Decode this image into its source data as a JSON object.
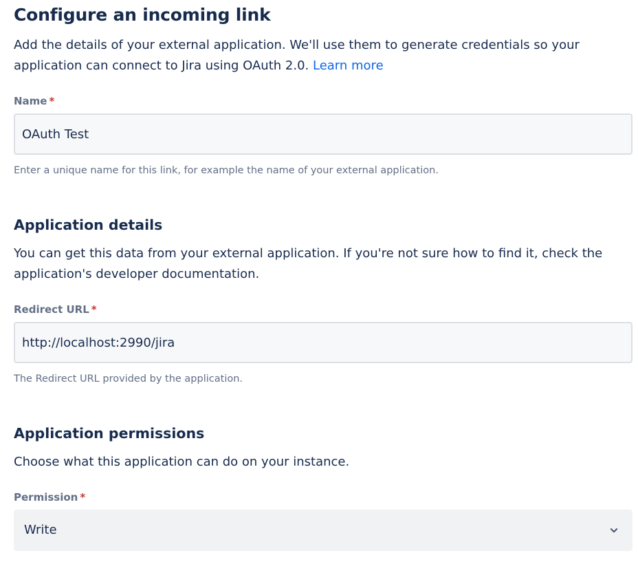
{
  "header": {
    "title": "Configure an incoming link",
    "intro": "Add the details of your external application. We'll use them to generate credentials so your application can connect to Jira using OAuth 2.0.",
    "learn_more": "Learn more"
  },
  "name_field": {
    "label": "Name",
    "required_mark": "*",
    "value": "OAuth Test",
    "helper": "Enter a unique name for this link, for example the name of your external application."
  },
  "application_details": {
    "heading": "Application details",
    "description": "You can get this data from your external application. If you're not sure how to find it, check the application's developer documentation."
  },
  "redirect_field": {
    "label": "Redirect URL",
    "required_mark": "*",
    "value": "http://localhost:2990/jira",
    "helper": "The Redirect URL provided by the application."
  },
  "application_permissions": {
    "heading": "Application permissions",
    "description": "Choose what this application can do on your instance."
  },
  "permission_field": {
    "label": "Permission",
    "required_mark": "*",
    "selected": "Write",
    "icon": "chevron-down-icon"
  },
  "colors": {
    "text": "#172b4d",
    "subtle_text": "#626f86",
    "link": "#0c66e4",
    "required": "#c9372c",
    "input_bg": "#f7f8f9",
    "input_border": "#dcdfe4",
    "select_bg": "#f1f2f4"
  }
}
